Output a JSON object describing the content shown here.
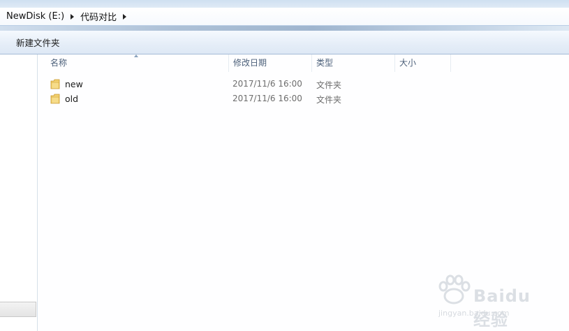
{
  "breadcrumb": {
    "items": [
      "NewDisk (E:)",
      "代码对比"
    ]
  },
  "command_bar": {
    "new_folder_label": "新建文件夹"
  },
  "columns": {
    "name": "名称",
    "modified": "修改日期",
    "type": "类型",
    "size": "大小"
  },
  "files": [
    {
      "name": "new",
      "modified": "2017/11/6 16:00",
      "type": "文件夹",
      "size": ""
    },
    {
      "name": "old",
      "modified": "2017/11/6 16:00",
      "type": "文件夹",
      "size": ""
    }
  ],
  "watermark": {
    "brand": "Baidu 经验",
    "url": "jingyan.baidu.com"
  },
  "colors": {
    "folder": "#e8b84a",
    "header_text": "#4c607a",
    "accent": "#a5bbd6"
  }
}
